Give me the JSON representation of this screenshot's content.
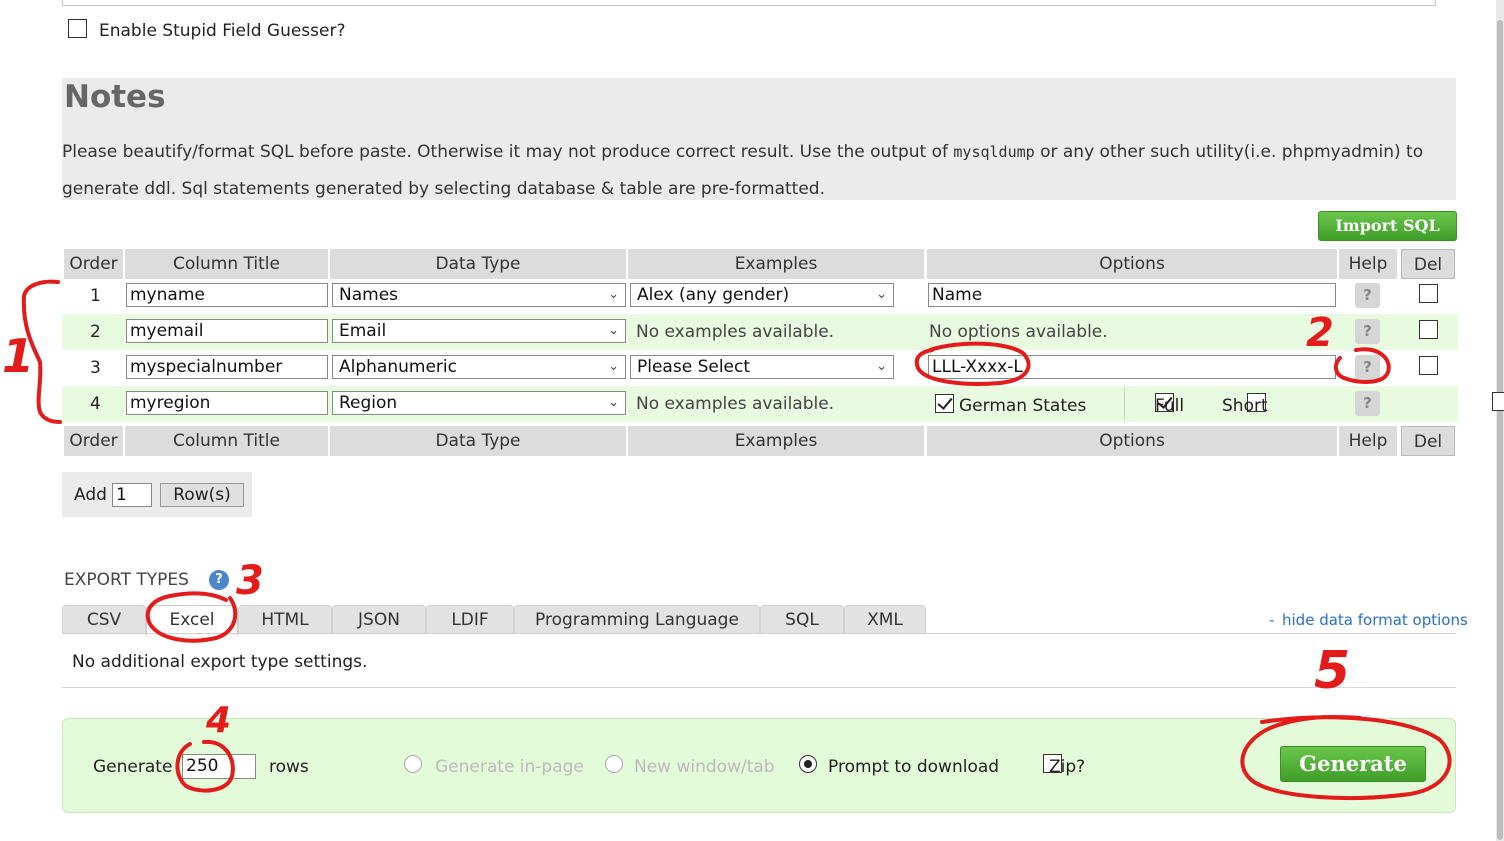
{
  "guesser": {
    "label": "Enable Stupid Field Guesser?",
    "checked": false
  },
  "notes": {
    "title": "Notes",
    "text_before": "Please beautify/format SQL before paste. Otherwise it may not produce correct result. Use the output of ",
    "code": "mysqldump",
    "text_after": " or any other such utility(i.e. phpmyadmin) to generate ddl. Sql statements generated by selecting database & table are pre-formatted."
  },
  "import_button": "Import SQL",
  "grid": {
    "headers": {
      "order": "Order",
      "column_title": "Column Title",
      "data_type": "Data Type",
      "examples": "Examples",
      "options": "Options",
      "help": "Help",
      "del": "Del"
    },
    "rows": [
      {
        "order": "1",
        "title": "myname",
        "type": "Names",
        "example": "Alex (any gender)",
        "option_value": "Name"
      },
      {
        "order": "2",
        "title": "myemail",
        "type": "Email",
        "example_text": "No examples available.",
        "option_text": "No options available."
      },
      {
        "order": "3",
        "title": "myspecialnumber",
        "type": "Alphanumeric",
        "example": "Please Select",
        "option_value": "LLL-Xxxx-L"
      },
      {
        "order": "4",
        "title": "myregion",
        "type": "Region",
        "example_text": "No examples available.",
        "checks": [
          {
            "label": "German States",
            "checked": true
          },
          {
            "label": "Full",
            "checked": true
          },
          {
            "label": "Short",
            "checked": false
          }
        ]
      }
    ],
    "help_symbol": "?"
  },
  "add_rows": {
    "label": "Add",
    "value": "1",
    "button": "Row(s)"
  },
  "export": {
    "heading": "EXPORT TYPES",
    "tabs": [
      "CSV",
      "Excel",
      "HTML",
      "JSON",
      "LDIF",
      "Programming Language",
      "SQL",
      "XML"
    ],
    "active_tab": "Excel",
    "hide_link_prefix": "-",
    "hide_link": "hide data format options",
    "settings_text": "No additional export type settings."
  },
  "generate": {
    "label": "Generate",
    "rows_value": "250",
    "rows_label": "rows",
    "options": [
      {
        "label": "Generate in-page",
        "selected": false,
        "disabled": true
      },
      {
        "label": "New window/tab",
        "selected": false,
        "disabled": true
      },
      {
        "label": "Prompt to download",
        "selected": true,
        "disabled": false
      }
    ],
    "zip_label": "Zip?",
    "button": "Generate"
  },
  "annotations": {
    "color": "#e31b1b",
    "numbers": [
      "1",
      "2",
      "3",
      "4",
      "5"
    ]
  },
  "colors": {
    "green_row": "#e8fadf",
    "header_gray": "#dcdcdc",
    "notes_bg": "#ebebeb",
    "link": "#2a6fc9",
    "button_green": "#4aa832"
  }
}
